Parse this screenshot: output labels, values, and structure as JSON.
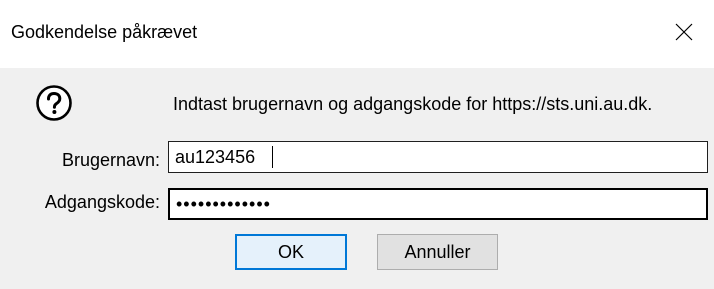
{
  "window": {
    "title": "Godkendelse påkrævet"
  },
  "dialog": {
    "message": "Indtast brugernavn og adgangskode for https://sts.uni.au.dk.",
    "username_label": "Brugernavn:",
    "username_value": "au123456",
    "password_label": "Adgangskode:",
    "password_mask": "•••••••••••••"
  },
  "buttons": {
    "ok_label": "OK",
    "cancel_label": "Annuller"
  },
  "icons": {
    "help": "question-circle-icon",
    "close": "close-icon"
  },
  "colors": {
    "dialog_background": "#f0f0f0",
    "default_button_border": "#0078d7",
    "default_button_fill": "#e5f1fb"
  }
}
